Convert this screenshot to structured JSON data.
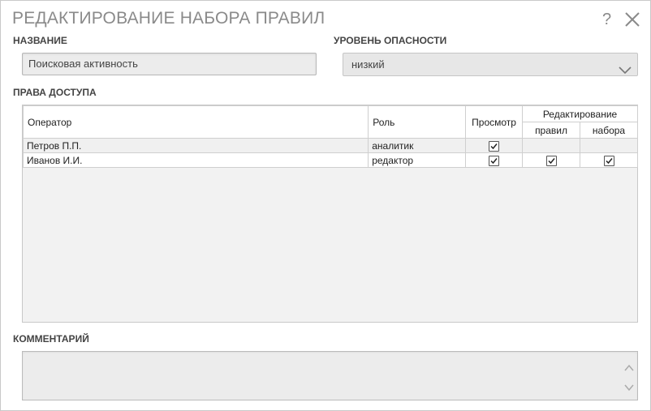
{
  "dialog": {
    "title": "РЕДАКТИРОВАНИЕ НАБОРА ПРАВИЛ",
    "help_icon": "?",
    "close_icon": "close-icon"
  },
  "name_field": {
    "label": "НАЗВАНИЕ",
    "value": "Поисковая активность"
  },
  "severity_field": {
    "label": "УРОВЕНЬ ОПАСНОСТИ",
    "value": "низкий"
  },
  "access": {
    "label": "ПРАВА ДОСТУПА",
    "columns": {
      "operator": "Оператор",
      "role": "Роль",
      "view": "Просмотр",
      "edit_group": "Редактирование",
      "edit_rules": "правил",
      "edit_set": "набора"
    },
    "rows": [
      {
        "operator": "Петров П.П.",
        "role": "аналитик",
        "view": true,
        "edit_rules": null,
        "edit_set": null
      },
      {
        "operator": "Иванов И.И.",
        "role": "редактор",
        "view": true,
        "edit_rules": true,
        "edit_set": true
      }
    ]
  },
  "comment": {
    "label": "КОММЕНТАРИЙ",
    "value": ""
  }
}
